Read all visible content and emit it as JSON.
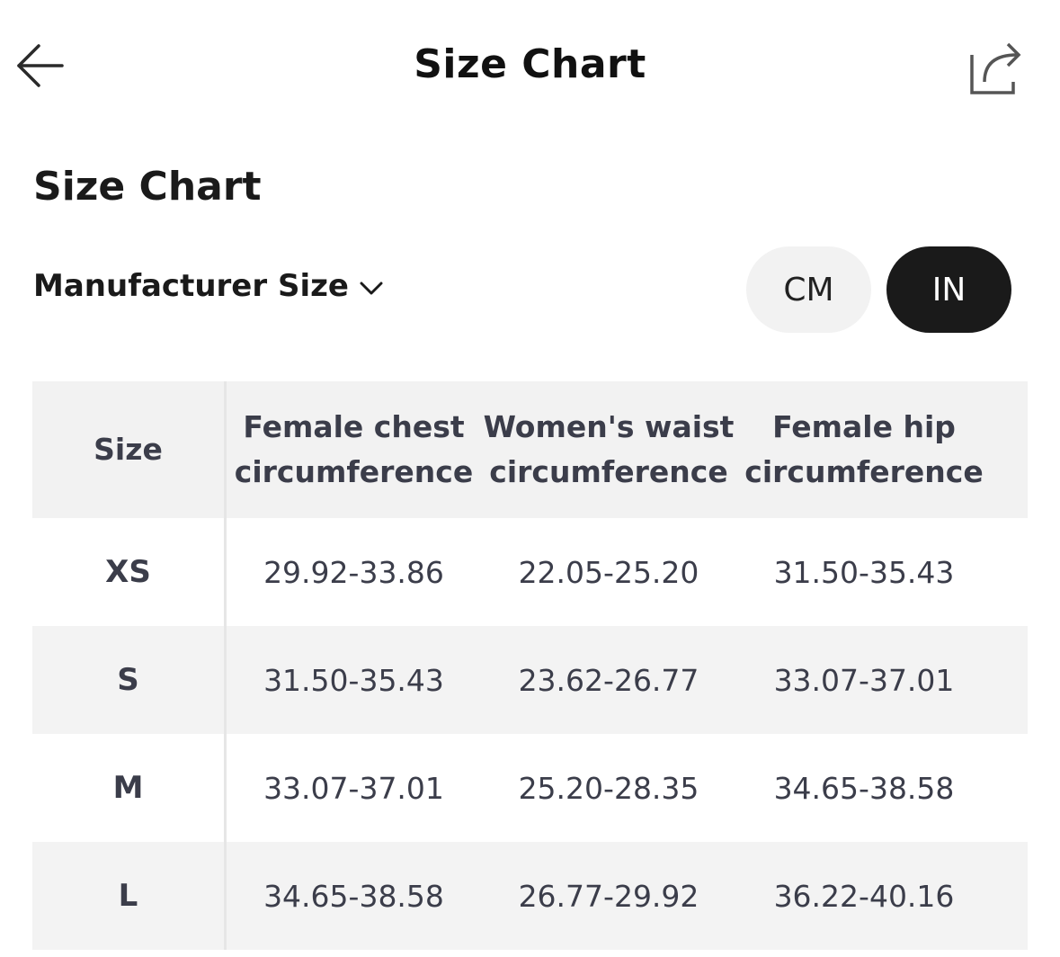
{
  "nav": {
    "title": "Size Chart",
    "back_icon": "back-arrow-icon",
    "share_icon": "share-icon"
  },
  "section": {
    "title": "Size Chart"
  },
  "size_type": {
    "label": "Manufacturer Size",
    "icon": "chevron-down-icon"
  },
  "units": {
    "cm": "CM",
    "in": "IN",
    "selected": "IN"
  },
  "table": {
    "headers": [
      "Size",
      "Female chest circumference",
      "Women's waist circumference",
      "Female hip circumference"
    ],
    "rows": [
      [
        "XS",
        "29.92-33.86",
        "22.05-25.20",
        "31.50-35.43"
      ],
      [
        "S",
        "31.50-35.43",
        "23.62-26.77",
        "33.07-37.01"
      ],
      [
        "M",
        "33.07-37.01",
        "25.20-28.35",
        "34.65-38.58"
      ],
      [
        "L",
        "34.65-38.58",
        "26.77-29.92",
        "36.22-40.16"
      ]
    ]
  },
  "colors": {
    "selected_unit_bg": "#1a1a1a",
    "unselected_unit_bg": "#f2f2f2",
    "header_bg": "#f2f2f2",
    "alt_row_bg": "#f3f3f3",
    "table_text": "#3b3d4a"
  }
}
